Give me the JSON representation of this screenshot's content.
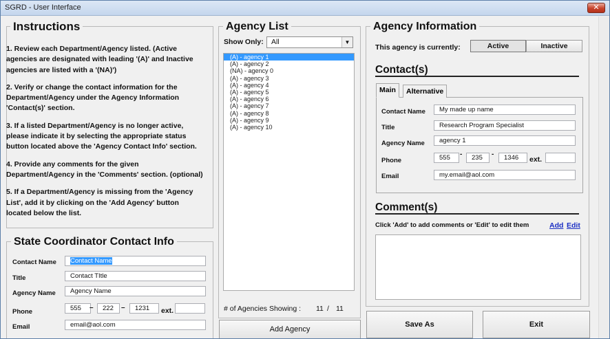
{
  "window": {
    "title": "SGRD - User Interface",
    "close_glyph": "✕"
  },
  "instructions": {
    "title": "Instructions",
    "steps": [
      "1. Review each Department/Agency listed. (Active agencies are designated with leading '(A)' and Inactive agencies are listed with a '(NA)')",
      "2. Verify or change the contact information for the Department/Agency under the Agency Information 'Contact(s)' section.",
      "3. If a listed Department/Agency is no longer active, please indicate it by selecting the appropriate status button located above the 'Agency Contact Info' section.",
      "4. Provide any comments for the given Department/Agency in the 'Comments' section. (optional)",
      "5. If a Department/Agency is missing from the 'Agency List', add it by clicking on the 'Add Agency' button located below the list."
    ]
  },
  "coordinator": {
    "title": "State Coordinator Contact Info",
    "contact_name_label": "Contact Name",
    "contact_name_value": "Contact Name",
    "title_label": "Title",
    "title_value": "Contact TItle",
    "agency_name_label": "Agency Name",
    "agency_name_value": "Agency Name",
    "phone_label": "Phone",
    "phone_area": "555",
    "phone_prefix": "222",
    "phone_line": "1231",
    "phone_sep": "–",
    "ext_label": "ext.",
    "ext_value": "",
    "email_label": "Email",
    "email_value": "email@aol.com"
  },
  "agency_list": {
    "title": "Agency List",
    "show_only_label": "Show Only:",
    "show_only_value": "All",
    "dropdown_arrow": "▼",
    "items": [
      "(A) - agency 1",
      "(A) - agency 2",
      "(NA) - agency 0",
      "(A) - agency 3",
      "(A) - agency 4",
      "(A) - agency 5",
      "(A) - agency 6",
      "(A) - agency 7",
      "(A) - agency 8",
      "(A) - agency 9",
      "(A) - agency 10"
    ],
    "selected_index": 0,
    "count_label": "# of Agencies Showing :",
    "showing": "11",
    "count_sep": "/",
    "total": "11",
    "add_button": "Add Agency"
  },
  "agency_info": {
    "title": "Agency Information",
    "status_label": "This agency is currently:",
    "active_label": "Active",
    "inactive_label": "Inactive",
    "contacts_heading": "Contact(s)",
    "tabs": [
      "Main",
      "Alternative"
    ],
    "contact_name_label": "Contact Name",
    "contact_name_value": "My made up name",
    "title_label": "Title",
    "title_value": "Research Program Specialist",
    "agency_name_label": "Agency Name",
    "agency_name_value": "agency 1",
    "phone_label": "Phone",
    "phone_area": "555",
    "phone_prefix": "235",
    "phone_line": "1346",
    "phone_sep": "-",
    "ext_label": "ext.",
    "ext_value": "",
    "email_label": "Email",
    "email_value": "my.email@aol.com",
    "comments_heading": "Comment(s)",
    "comments_hint": "Click 'Add' to add comments or 'Edit' to edit them",
    "add_link": "Add",
    "edit_link": "Edit",
    "comments_text": ""
  },
  "footer": {
    "save_as": "Save As",
    "exit": "Exit"
  }
}
